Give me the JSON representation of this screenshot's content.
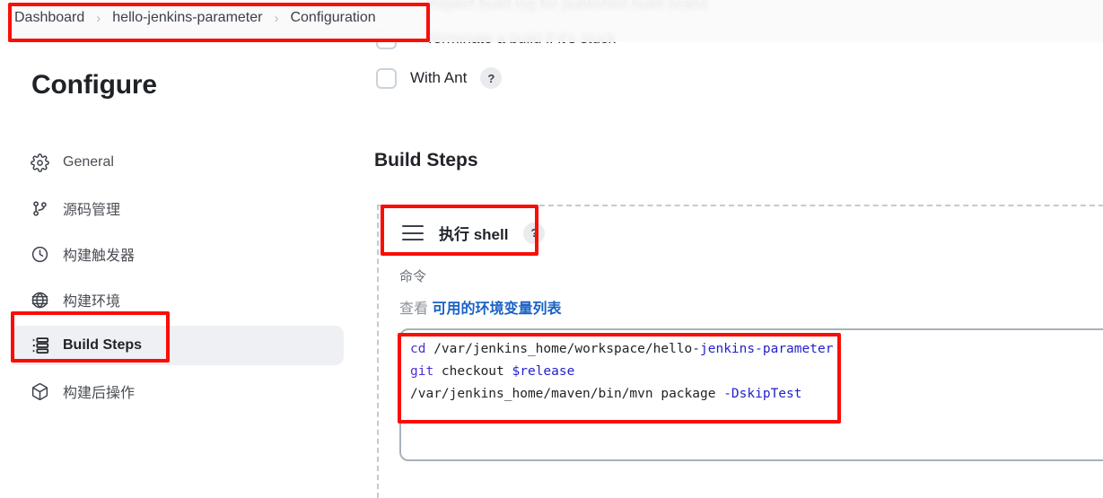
{
  "breadcrumb": {
    "items": [
      {
        "label": "Dashboard"
      },
      {
        "label": "hello-jenkins-parameter"
      },
      {
        "label": "Configuration"
      }
    ],
    "separator": "›"
  },
  "sidebar": {
    "title": "Configure",
    "items": [
      {
        "label": "General",
        "icon": "gear-icon",
        "active": false
      },
      {
        "label": "源码管理",
        "icon": "git-branch-icon",
        "active": false
      },
      {
        "label": "构建触发器",
        "icon": "clock-icon",
        "active": false
      },
      {
        "label": "构建环境",
        "icon": "globe-icon",
        "active": false
      },
      {
        "label": "Build Steps",
        "icon": "list-icon",
        "active": true
      },
      {
        "label": "构建后操作",
        "icon": "package-icon",
        "active": false
      }
    ]
  },
  "main": {
    "scrolled_under": {
      "line1": "Inspect build log for published build scans",
      "line2": "Terminate a build if it's stuck"
    },
    "with_ant": {
      "label": "With Ant",
      "help": "?",
      "checked": false
    },
    "section_title": "Build Steps",
    "build_step": {
      "name": "执行 shell",
      "help": "?",
      "command_label": "命令",
      "env_prefix": "查看",
      "env_link": "可用的环境变量列表",
      "code": {
        "line1": {
          "cmd": "cd",
          "plain": " /var/jenkins_home/workspace/hello-",
          "arg": "jenkins-parameter"
        },
        "line2": {
          "cmd": "git",
          "plain": " checkout ",
          "arg": "$release"
        },
        "line3": {
          "cmd": "",
          "plain": "/var/jenkins_home/maven/bin/mvn package ",
          "arg": "-DskipTest"
        }
      }
    }
  },
  "colors": {
    "annotation": "#fb0d07",
    "link": "#1b62c4",
    "active_nav_bg": "#eef0f3",
    "code_command": "#4b2fd6",
    "code_argument": "#2222cc"
  }
}
